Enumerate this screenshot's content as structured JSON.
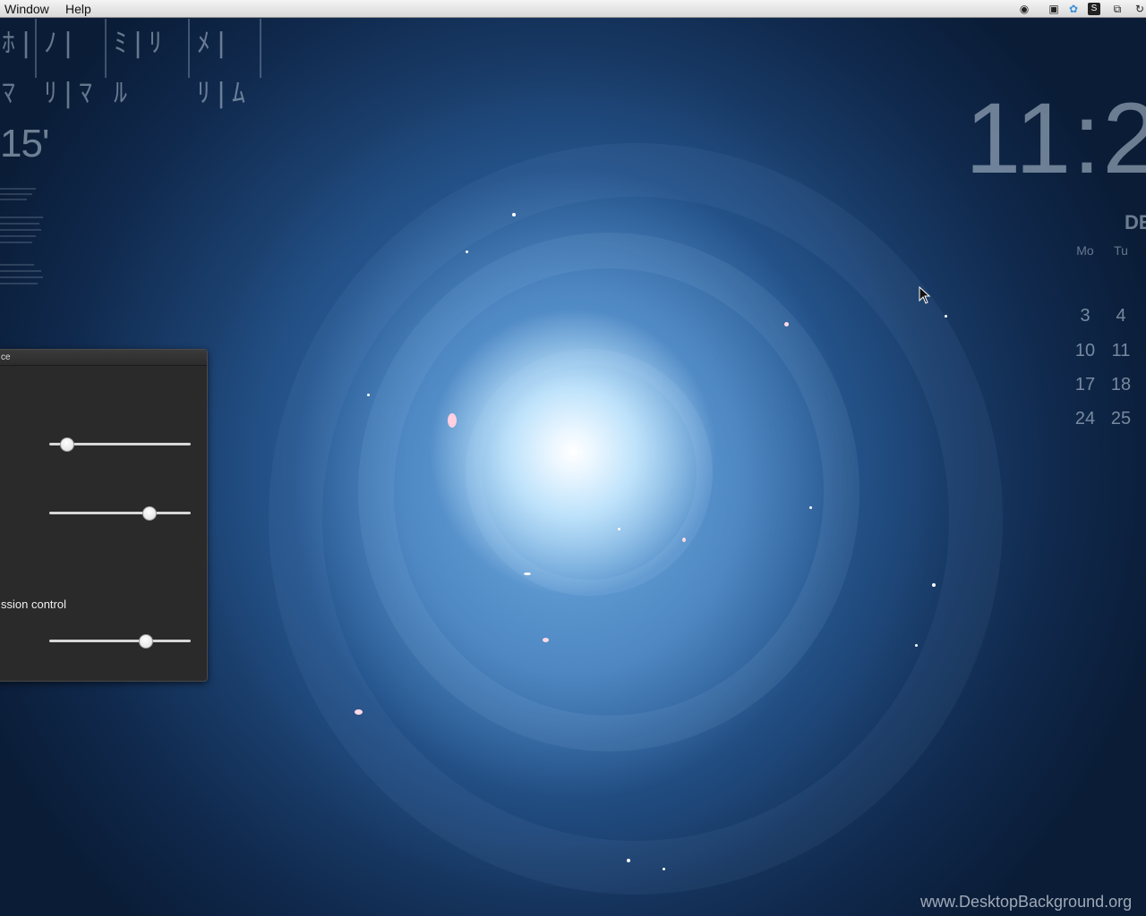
{
  "menubar": {
    "items": [
      "Window",
      "Help"
    ],
    "tray_icons": [
      "record-icon",
      "camera-icon",
      "cloud-sync-icon",
      "s-badge-icon",
      "screens-icon",
      "time-machine-icon"
    ]
  },
  "desktop": {
    "glyph_widget": {
      "glyphs": [
        "ﾎ|ﾏ",
        "ﾉ|ﾘ|ﾏ",
        "ﾐ|ﾘ ﾙ",
        "ﾒ|ﾘ|ﾑ"
      ]
    },
    "temperature": "15'",
    "clock": {
      "time": "11:2",
      "month": "DE",
      "weekday_headers": [
        "Mo",
        "Tu"
      ],
      "rows": [
        [
          "3",
          "4"
        ],
        [
          "10",
          "11"
        ],
        [
          "17",
          "18"
        ],
        [
          "24",
          "25"
        ]
      ]
    },
    "watermark": "www.DesktopBackground.org"
  },
  "panel": {
    "title": "ce",
    "sliders": [
      {
        "name": "slider-1",
        "value": 0.12
      },
      {
        "name": "slider-2",
        "value": 0.7
      },
      {
        "name": "slider-3",
        "value": 0.68
      }
    ],
    "section_label": "ssion control"
  },
  "colors": {
    "menubar": "#e5e5e5",
    "panel_bg": "#2a2a2a",
    "wallpaper_core": "#eaf6ff",
    "wallpaper_dark": "#0d2442"
  }
}
